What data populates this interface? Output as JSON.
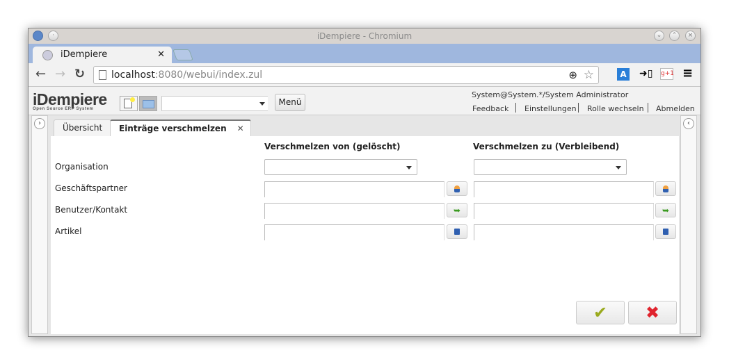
{
  "window": {
    "title": "iDempiere - Chromium"
  },
  "browser": {
    "tab_label": "iDempiere",
    "url_host": "localhost",
    "url_rest": ":8080/webui/index.zul"
  },
  "app": {
    "logo": "iDempiere",
    "logo_sub": "Open Source ERP System",
    "menu_label": "Menü",
    "user": "System@System.*/System Administrator",
    "links": [
      "Feedback",
      "Einstellungen",
      "Rolle wechseln",
      "Abmelden"
    ],
    "tabs": [
      {
        "label": "Übersicht",
        "active": false
      },
      {
        "label": "Einträge verschmelzen",
        "active": true
      }
    ]
  },
  "form": {
    "col_from": "Verschmelzen von (gelöscht)",
    "col_to": "Verschmelzen zu (Verbleibend)",
    "rows": [
      {
        "label": "Organisation",
        "type": "select",
        "from": "",
        "to": ""
      },
      {
        "label": "Geschäftspartner",
        "type": "search",
        "icon": "person-icon",
        "from": "",
        "to": ""
      },
      {
        "label": "Benutzer/Kontakt",
        "type": "search",
        "icon": "green-arrow-icon",
        "from": "",
        "to": ""
      },
      {
        "label": "Artikel",
        "type": "search",
        "icon": "product-box-icon",
        "from": "",
        "to": ""
      }
    ],
    "ok_icon": "checkmark-icon",
    "cancel_icon": "red-x-icon",
    "colors": {
      "ok": "#9aaa1e",
      "cancel": "#e0242e"
    }
  }
}
